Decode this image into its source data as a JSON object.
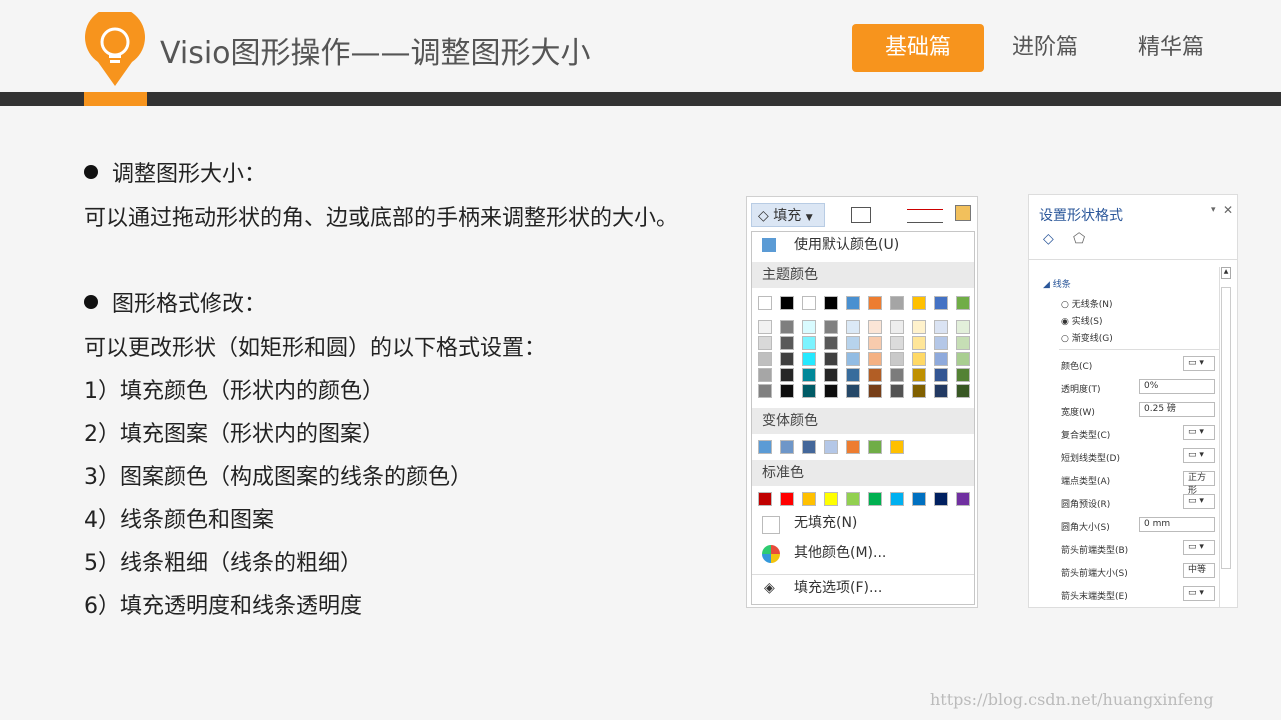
{
  "header": {
    "title": "Visio图形操作——调整图形大小",
    "tabs": [
      {
        "label": "基础篇",
        "active": true
      },
      {
        "label": "进阶篇",
        "active": false
      },
      {
        "label": "精华篇",
        "active": false
      }
    ],
    "accent_color": "#f7941d",
    "logo_icon": "lightbulb-icon"
  },
  "content": {
    "section1_heading": "调整图形大小：",
    "section1_text": "可以通过拖动形状的角、边或底部的手柄来调整形状的大小。",
    "section2_heading": "图形格式修改：",
    "section2_text": "可以更改形状（如矩形和圆）的以下格式设置：",
    "items": [
      "1）填充颜色（形状内的颜色）",
      "2）填充图案（形状内的图案）",
      "3）图案颜色（构成图案的线条的颜色）",
      "4）线条颜色和图案",
      "5）线条粗细（线条的粗细）",
      "6）填充透明度和线条透明度"
    ]
  },
  "fill_menu": {
    "button_label": "填充",
    "default_color": "使用默认颜色(U)",
    "theme_colors_label": "主题颜色",
    "variant_colors_label": "变体颜色",
    "standard_colors_label": "标准色",
    "no_fill": "无填充(N)",
    "more_colors": "其他颜色(M)...",
    "fill_options": "填充选项(F)...",
    "theme_top_row": [
      "#ffffff",
      "#000000",
      "#ffffff",
      "#000000",
      "#4a90d0",
      "#ed7d31",
      "#a5a5a5",
      "#ffc000",
      "#4472c4",
      "#70ad47"
    ],
    "variant_colors": [
      "#5b9bd5",
      "#6e96c8",
      "#44679a",
      "#b4c7e7",
      "#ed7d31",
      "#70ad47",
      "#ffc000"
    ],
    "standard_colors": [
      "#c00000",
      "#ff0000",
      "#ffc000",
      "#ffff00",
      "#92d050",
      "#00b050",
      "#00b0f0",
      "#0070c0",
      "#002060",
      "#7030a0"
    ]
  },
  "format_pane": {
    "title": "设置形状格式",
    "section": "线条",
    "line_options": [
      "无线条(N)",
      "实线(S)",
      "渐变线(G)"
    ],
    "props": [
      {
        "label": "颜色(C)",
        "value": ""
      },
      {
        "label": "透明度(T)",
        "value": "0%"
      },
      {
        "label": "宽度(W)",
        "value": "0.25 磅"
      },
      {
        "label": "复合类型(C)",
        "value": ""
      },
      {
        "label": "短划线类型(D)",
        "value": ""
      },
      {
        "label": "端点类型(A)",
        "value": "正方形"
      },
      {
        "label": "圆角预设(R)",
        "value": ""
      },
      {
        "label": "圆角大小(S)",
        "value": "0 mm"
      },
      {
        "label": "箭头前端类型(B)",
        "value": ""
      },
      {
        "label": "箭头前端大小(S)",
        "value": "中等"
      },
      {
        "label": "箭头末端类型(E)",
        "value": ""
      }
    ]
  },
  "watermark": "https://blog.csdn.net/huangxinfeng"
}
